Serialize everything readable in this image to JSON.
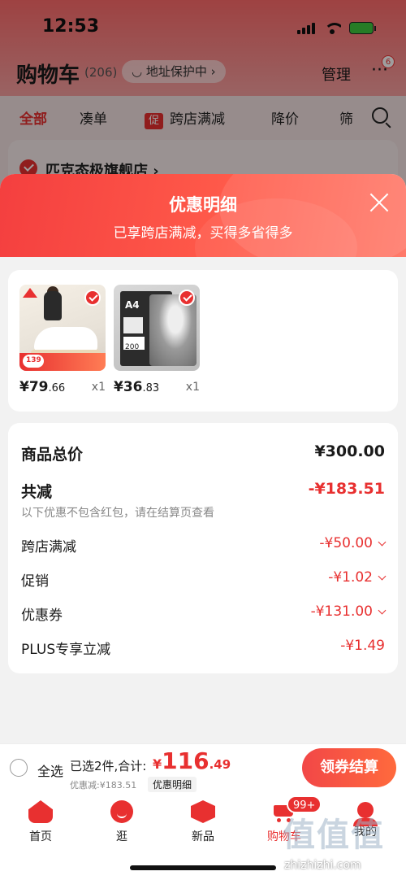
{
  "status_bar": {
    "time": "12:53"
  },
  "cart_header": {
    "title": "购物车",
    "count": "(206)",
    "address_protection": "地址保护中",
    "manage": "管理",
    "more_badge": "6"
  },
  "filter_tabs": [
    {
      "label": "全部",
      "active": true
    },
    {
      "label": "凑单"
    },
    {
      "tag": "促",
      "label": "跨店满减"
    },
    {
      "label": "降价"
    },
    {
      "label": "筛"
    }
  ],
  "store": {
    "name": "匹克态极旗舰店"
  },
  "sheet": {
    "title": "优惠明细",
    "subtitle": "已享跨店满减，买得多省得多"
  },
  "products": [
    {
      "price_int": "¥79",
      "price_dec": ".66",
      "qty": "x1",
      "tag_price": "139",
      "selected": true
    },
    {
      "price_int": "¥36",
      "price_dec": ".83",
      "qty": "x1",
      "badge": "A4",
      "label": "200",
      "selected": true
    }
  ],
  "details": {
    "total_label": "商品总价",
    "total_value": "¥300.00",
    "reduce_label": "共减",
    "reduce_value": "-¥183.51",
    "reduce_note": "以下优惠不包含红包，请在结算页查看",
    "items": [
      {
        "label": "跨店满减",
        "value": "-¥50.00"
      },
      {
        "label": "促销",
        "value": "-¥1.02"
      },
      {
        "label": "优惠券",
        "value": "-¥131.00"
      },
      {
        "label": "PLUS专享立减",
        "value": "-¥1.49"
      }
    ]
  },
  "checkout": {
    "select_all": "全选",
    "summary": "已选2件,合计:",
    "total_symbol": "¥",
    "total_int": "116",
    "total_dec": ".49",
    "reduced": "优惠减:¥183.51",
    "detail_link": "优惠明细",
    "button": "领券结算"
  },
  "bottom_nav": [
    {
      "label": "首页",
      "icon": "home-icon"
    },
    {
      "label": "逛",
      "icon": "stroll-icon"
    },
    {
      "label": "新品",
      "icon": "new-products-icon"
    },
    {
      "label": "购物车",
      "icon": "cart-icon",
      "active": true,
      "badge": "99+"
    },
    {
      "label": "我的",
      "icon": "profile-icon"
    }
  ],
  "watermark": {
    "logo": "值",
    "url": "zhizhizhi.com"
  },
  "colors": {
    "accent": "#e83030",
    "sheet_header": "#f43f3f"
  }
}
